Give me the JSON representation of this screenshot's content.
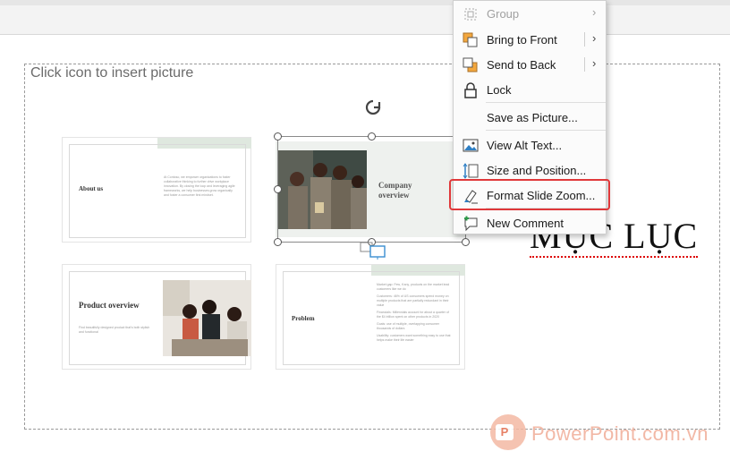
{
  "placeholder": {
    "text": "Click icon to insert picture"
  },
  "zooms": {
    "about": {
      "title": "About us",
      "body": "At Contoso, we empower organizations to foster collaborative thinking to further drive workplace innovation. By closing the loop and leveraging agile frameworks, we help businesses grow organically and foster a consumer first mindset."
    },
    "company": {
      "title": "Company overview"
    },
    "product": {
      "title": "Product overview",
      "body": "Find beautifully designed product that's both stylish and functional"
    },
    "problem": {
      "title": "Problem",
      "bullets": [
        "Market gap: Few, if any, products on the market lead customers like we do",
        "Customers: 46% of US consumers spend money on multiple products that are partially redundant in their value",
        "Financials: Millennials account for about a quarter of the $4 trillion spent on other products in 2020",
        "Goals: use of multiple, overlapping consumer thousands of dollars",
        "Usability: customers want something easy to use that helps make their life easier"
      ]
    }
  },
  "slide_text": {
    "muc_luc": "MỤC LỤC"
  },
  "context_menu": {
    "items": [
      {
        "label": "Group",
        "icon": "group-icon",
        "has_submenu": true,
        "disabled": true
      },
      {
        "label": "Bring to Front",
        "icon": "bring-to-front-icon",
        "has_submenu": true
      },
      {
        "label": "Send to Back",
        "icon": "send-to-back-icon",
        "has_submenu": true
      },
      {
        "label": "Lock",
        "icon": "lock-icon"
      },
      {
        "label": "Save as Picture...",
        "icon": ""
      },
      {
        "label": "View Alt Text...",
        "icon": "alt-text-icon"
      },
      {
        "label": "Size and Position...",
        "icon": "size-position-icon"
      },
      {
        "label": "Format Slide Zoom...",
        "icon": "format-slide-zoom-icon",
        "highlighted": true
      },
      {
        "label": "New Comment",
        "icon": "new-comment-icon"
      }
    ]
  },
  "watermark": {
    "text": "PowerPoint.com.vn",
    "logo_letter": "P"
  },
  "colors": {
    "highlight": "#e0383a",
    "accent_green": "#dfe8df",
    "watermark": "#f2b8a6"
  }
}
